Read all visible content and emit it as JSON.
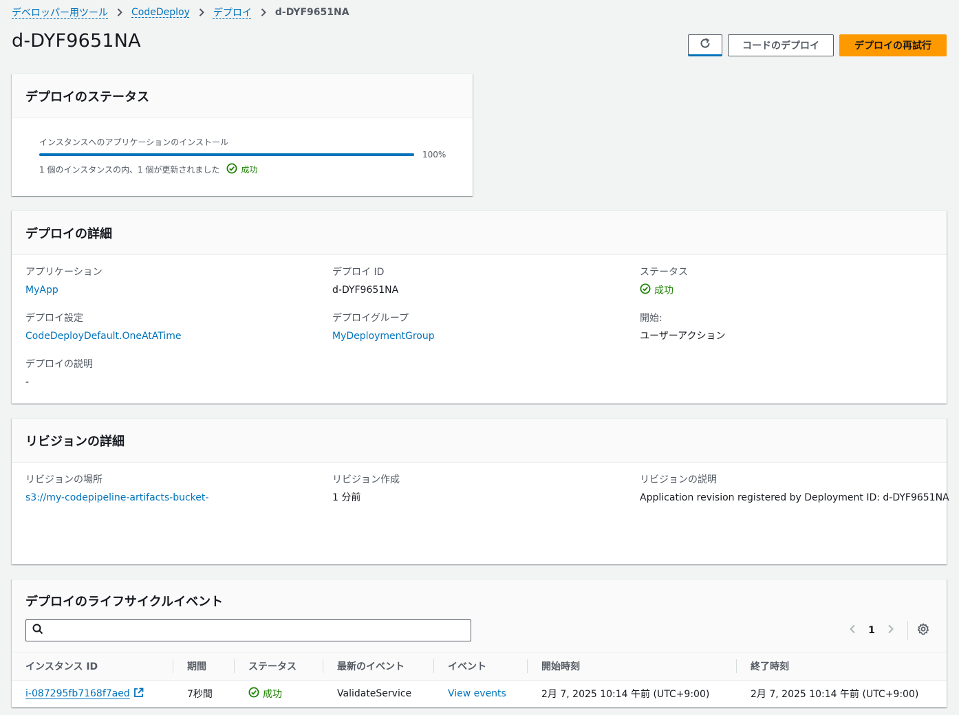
{
  "breadcrumb": {
    "items": [
      "デベロッパー用ツール",
      "CodeDeploy",
      "デプロイ"
    ],
    "current": "d-DYF9651NA"
  },
  "page": {
    "title": "d-DYF9651NA"
  },
  "actions": {
    "deploy_code": "コードのデプロイ",
    "retry_deploy": "デプロイの再試行"
  },
  "status_panel": {
    "title": "デプロイのステータス",
    "progress_label": "インスタンスへのアプリケーションのインストール",
    "progress_percent": 100,
    "progress_text": "100%",
    "description": "1 個のインスタンスの内、1 個が更新されました",
    "status": "成功"
  },
  "details_panel": {
    "title": "デプロイの詳細",
    "application_label": "アプリケーション",
    "application_value": "MyApp",
    "deployment_id_label": "デプロイ ID",
    "deployment_id_value": "d-DYF9651NA",
    "status_label": "ステータス",
    "status_value": "成功",
    "config_label": "デプロイ設定",
    "config_value": "CodeDeployDefault.OneAtATime",
    "group_label": "デプロイグループ",
    "group_value": "MyDeploymentGroup",
    "start_label": "開始:",
    "start_value": "ユーザーアクション",
    "description_label": "デプロイの説明",
    "description_value": "-"
  },
  "revision_panel": {
    "title": "リビジョンの詳細",
    "location_label": "リビジョンの場所",
    "location_value": "s3://my-codepipeline-artifacts-bucket-",
    "created_label": "リビジョン作成",
    "created_value": "1 分前",
    "desc_label": "リビジョンの説明",
    "desc_value": "Application revision registered by Deployment ID: d-DYF9651NA"
  },
  "lifecycle_panel": {
    "title": "デプロイのライフサイクルイベント",
    "search_placeholder": "",
    "page_number": "1",
    "columns": [
      "インスタンス ID",
      "期間",
      "ステータス",
      "最新のイベント",
      "イベント",
      "開始時刻",
      "終了時刻"
    ],
    "rows": [
      {
        "instance_id": "i-087295fb7168f7aed",
        "duration": "7秒間",
        "status": "成功",
        "latest_event": "ValidateService",
        "events_link": "View events",
        "start_time": "2月 7, 2025 10:14 午前 (UTC+9:00)",
        "end_time": "2月 7, 2025 10:14 午前 (UTC+9:00)"
      }
    ]
  },
  "colors": {
    "link": "#0073bb",
    "success": "#1d8102",
    "primary_button": "#ff9900",
    "background": "#f2f3f3"
  }
}
